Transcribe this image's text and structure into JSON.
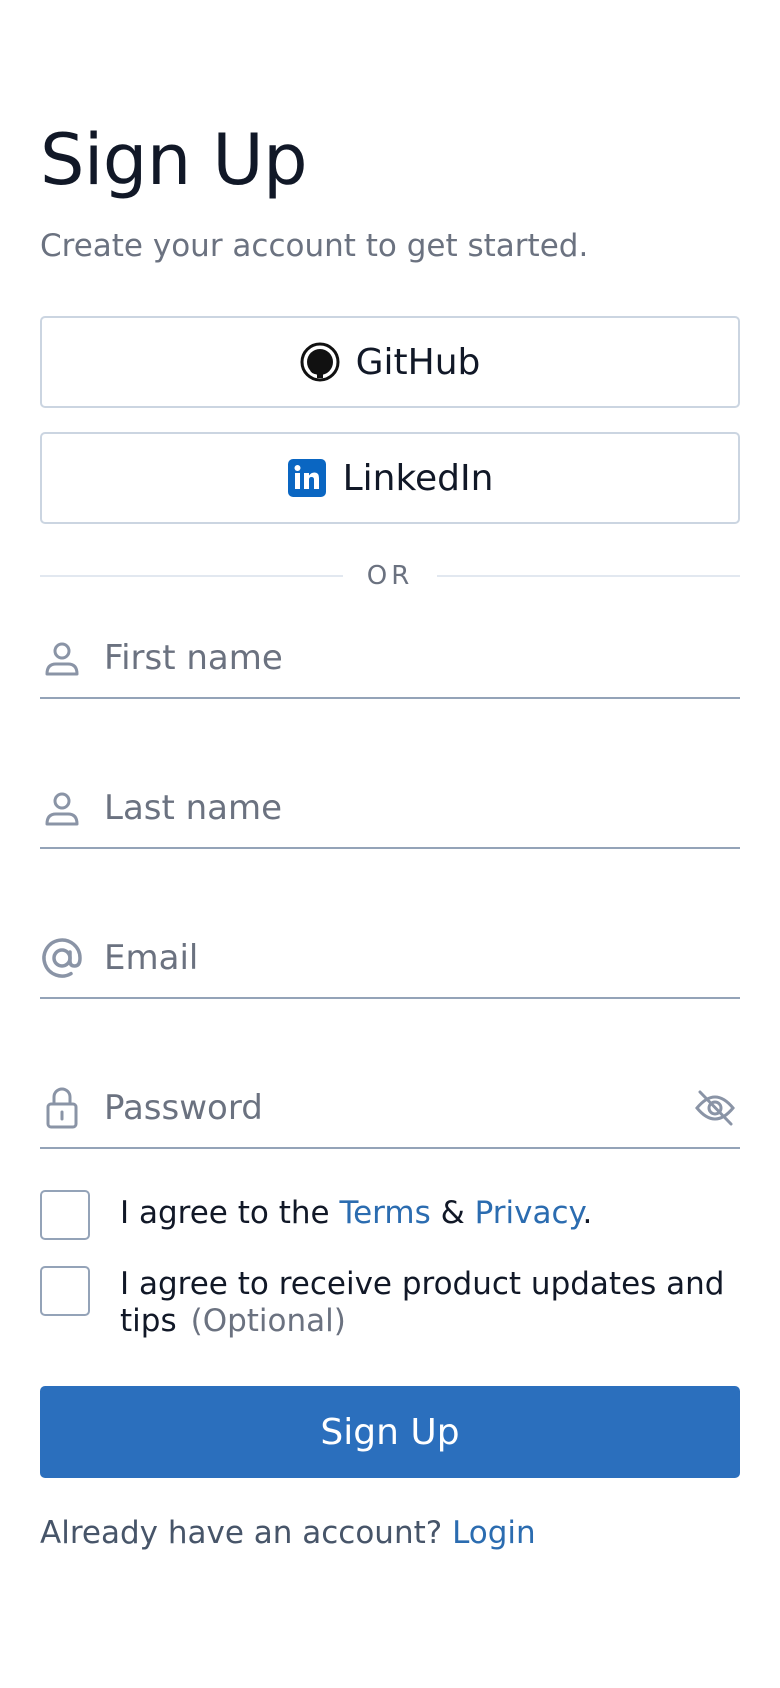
{
  "page": {
    "title": "Sign Up",
    "subtitle": "Create your account to get started."
  },
  "social": {
    "github_label": "GitHub",
    "linkedin_label": "LinkedIn",
    "github_icon": "github-icon",
    "linkedin_icon": "linkedin-icon"
  },
  "divider": {
    "text": "OR"
  },
  "fields": {
    "first_name": {
      "placeholder": "First name",
      "value": "",
      "icon": "user-icon"
    },
    "last_name": {
      "placeholder": "Last name",
      "value": "",
      "icon": "user-icon"
    },
    "email": {
      "placeholder": "Email",
      "value": "",
      "icon": "at-sign-icon"
    },
    "password": {
      "placeholder": "Password",
      "value": "",
      "icon": "lock-icon",
      "toggle_icon": "eye-off-icon"
    }
  },
  "agreements": {
    "terms_prefix": "I agree to the ",
    "terms_link": "Terms",
    "terms_amp": " & ",
    "privacy_link": "Privacy",
    "terms_suffix": ".",
    "updates_text": "I agree to receive product updates and tips",
    "updates_optional": "(Optional)",
    "terms_checked": false,
    "updates_checked": false
  },
  "submit": {
    "label": "Sign Up"
  },
  "footer": {
    "prompt": "Already have an account? ",
    "login_link": "Login"
  },
  "colors": {
    "primary": "#2b6fbd",
    "link": "#2b6cb0",
    "linkedin": "#0a66c2",
    "muted_text": "#6b7280",
    "border": "#cbd5e1",
    "input_border": "#94a3b8"
  }
}
